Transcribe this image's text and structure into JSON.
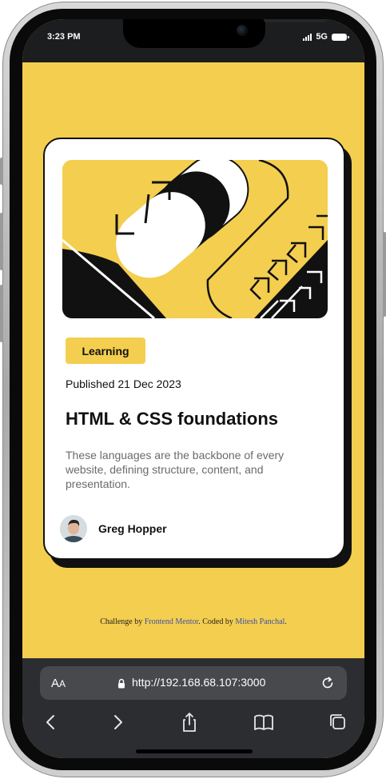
{
  "status_bar": {
    "time": "3:23 PM",
    "network": "5G",
    "icons": [
      "signal-icon",
      "battery-icon"
    ]
  },
  "card": {
    "tag": "Learning",
    "published": "Published 21 Dec 2023",
    "title": "HTML & CSS foundations",
    "description": "These languages are the backbone of every website, defining structure, content, and presentation.",
    "author": "Greg Hopper"
  },
  "attribution": {
    "prefix": "Challenge by ",
    "link1": "Frontend Mentor",
    "middle": ". Coded by ",
    "link2": "Mitesh Panchal",
    "suffix": "."
  },
  "browser": {
    "aa_label_big": "A",
    "aa_label_small": "A",
    "url": "http://192.168.68.107:3000",
    "nav_icons": [
      "back-icon",
      "forward-icon",
      "share-icon",
      "bookmarks-icon",
      "tabs-icon"
    ]
  },
  "colors": {
    "background": "#f4ce4f",
    "card": "#ffffff",
    "ink": "#111111",
    "link": "#3e52a3",
    "browser_chrome": "#2b2d30"
  }
}
